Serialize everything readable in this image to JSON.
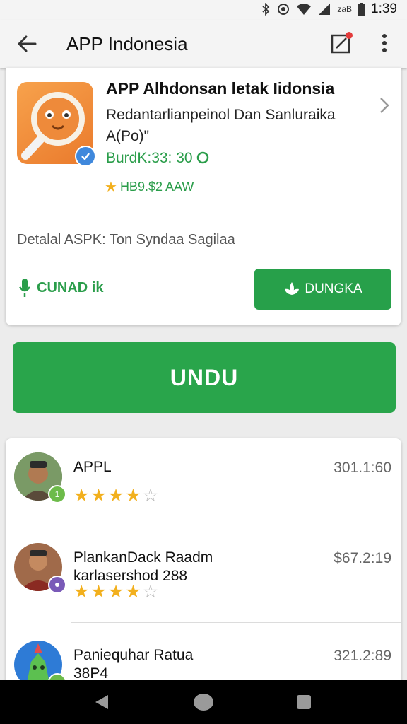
{
  "status_bar": {
    "time": "1:39",
    "network_label": "zaB",
    "icons": [
      "bluetooth-icon",
      "vibrate-icon",
      "wifi-icon",
      "signal-icon",
      "battery-icon"
    ]
  },
  "app_bar": {
    "title": "APP Indonesia",
    "icons": [
      "back-arrow-icon",
      "edit-icon",
      "more-vert-icon"
    ]
  },
  "app_card": {
    "name": "APP Alhdonsan letak Iidonsia",
    "description": "Redantarlianpeinol Dan Sanluraika A(Po)\"",
    "price": "BurdK:33: 30",
    "rating": "HB9.$2 AAW",
    "detail": "Detalal ASPK: Ton Syndaa Sagilaa",
    "download_link_label": "CUNAD ik",
    "install_button_label": "DUNGKA"
  },
  "primary_button_label": "UNDU",
  "reviews": [
    {
      "name": "APPL",
      "subtitle": "",
      "amount": "301.1:60",
      "stars": 4,
      "badge": "1"
    },
    {
      "name": "PlankanDack Raadm",
      "subtitle": "karlasershod 288",
      "amount": "$67.2:19",
      "stars": 4,
      "badge": ""
    },
    {
      "name": "Paniequhar Ratua",
      "subtitle": "38P4",
      "amount": "321.2:89",
      "stars": 0,
      "badge": ""
    }
  ],
  "colors": {
    "accent_green": "#29a54b",
    "star_yellow": "#f2b01e",
    "verified_blue": "#3f88dc"
  },
  "nav_bar": {
    "icons": [
      "back-triangle-icon",
      "home-circle-icon",
      "recents-square-icon"
    ]
  }
}
